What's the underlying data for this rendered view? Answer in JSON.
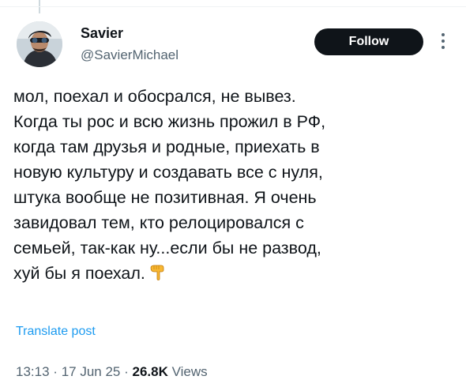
{
  "author": {
    "display_name": "Savier",
    "handle": "@SavierMichael",
    "avatar_icon": "user-avatar"
  },
  "follow_button": {
    "label": "Follow"
  },
  "more_menu_icon": "more-vertical-icon",
  "tweet": {
    "lines": [
      "мол, поехал и обосрался, не вывез.",
      "Когда ты рос и всю жизнь прожил в РФ,",
      "когда там друзья и родные, приехать в",
      "новую культуру и создавать все с нуля,",
      "штука вообще не позитивная. Я очень",
      "завидовал тем, кто релоцировался с",
      "семьей, так-как ну...если бы не развод,",
      "хуй бы я поехал."
    ],
    "trailing_emoji": "backhand-index-pointing-down-emoji"
  },
  "translate": {
    "label": "Translate post"
  },
  "meta": {
    "time": "13:13",
    "separator": "·",
    "date": "17 Jun 25",
    "views_count": "26.8K",
    "views_label": "Views"
  }
}
